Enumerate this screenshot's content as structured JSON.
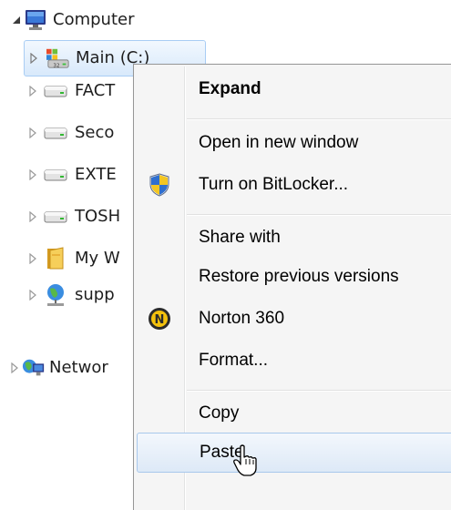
{
  "tree": {
    "computer": "Computer",
    "items": [
      {
        "label": "Main (C:)"
      },
      {
        "label": "FACT"
      },
      {
        "label": "Seco"
      },
      {
        "label": "EXTE"
      },
      {
        "label": "TOSH"
      },
      {
        "label": "My W"
      },
      {
        "label": "supp"
      }
    ],
    "network": "Networ"
  },
  "menu": {
    "items": [
      {
        "label": "Expand"
      },
      {
        "label": "Open in new window"
      },
      {
        "label": "Turn on BitLocker..."
      },
      {
        "label": "Share with"
      },
      {
        "label": "Restore previous versions"
      },
      {
        "label": "Norton 360"
      },
      {
        "label": "Format..."
      },
      {
        "label": "Copy"
      },
      {
        "label": "Paste"
      }
    ]
  },
  "colors": {
    "selection": "#d8e9fb",
    "menu_bg": "#f5f5f5",
    "norton_yellow": "#f4c20d"
  }
}
